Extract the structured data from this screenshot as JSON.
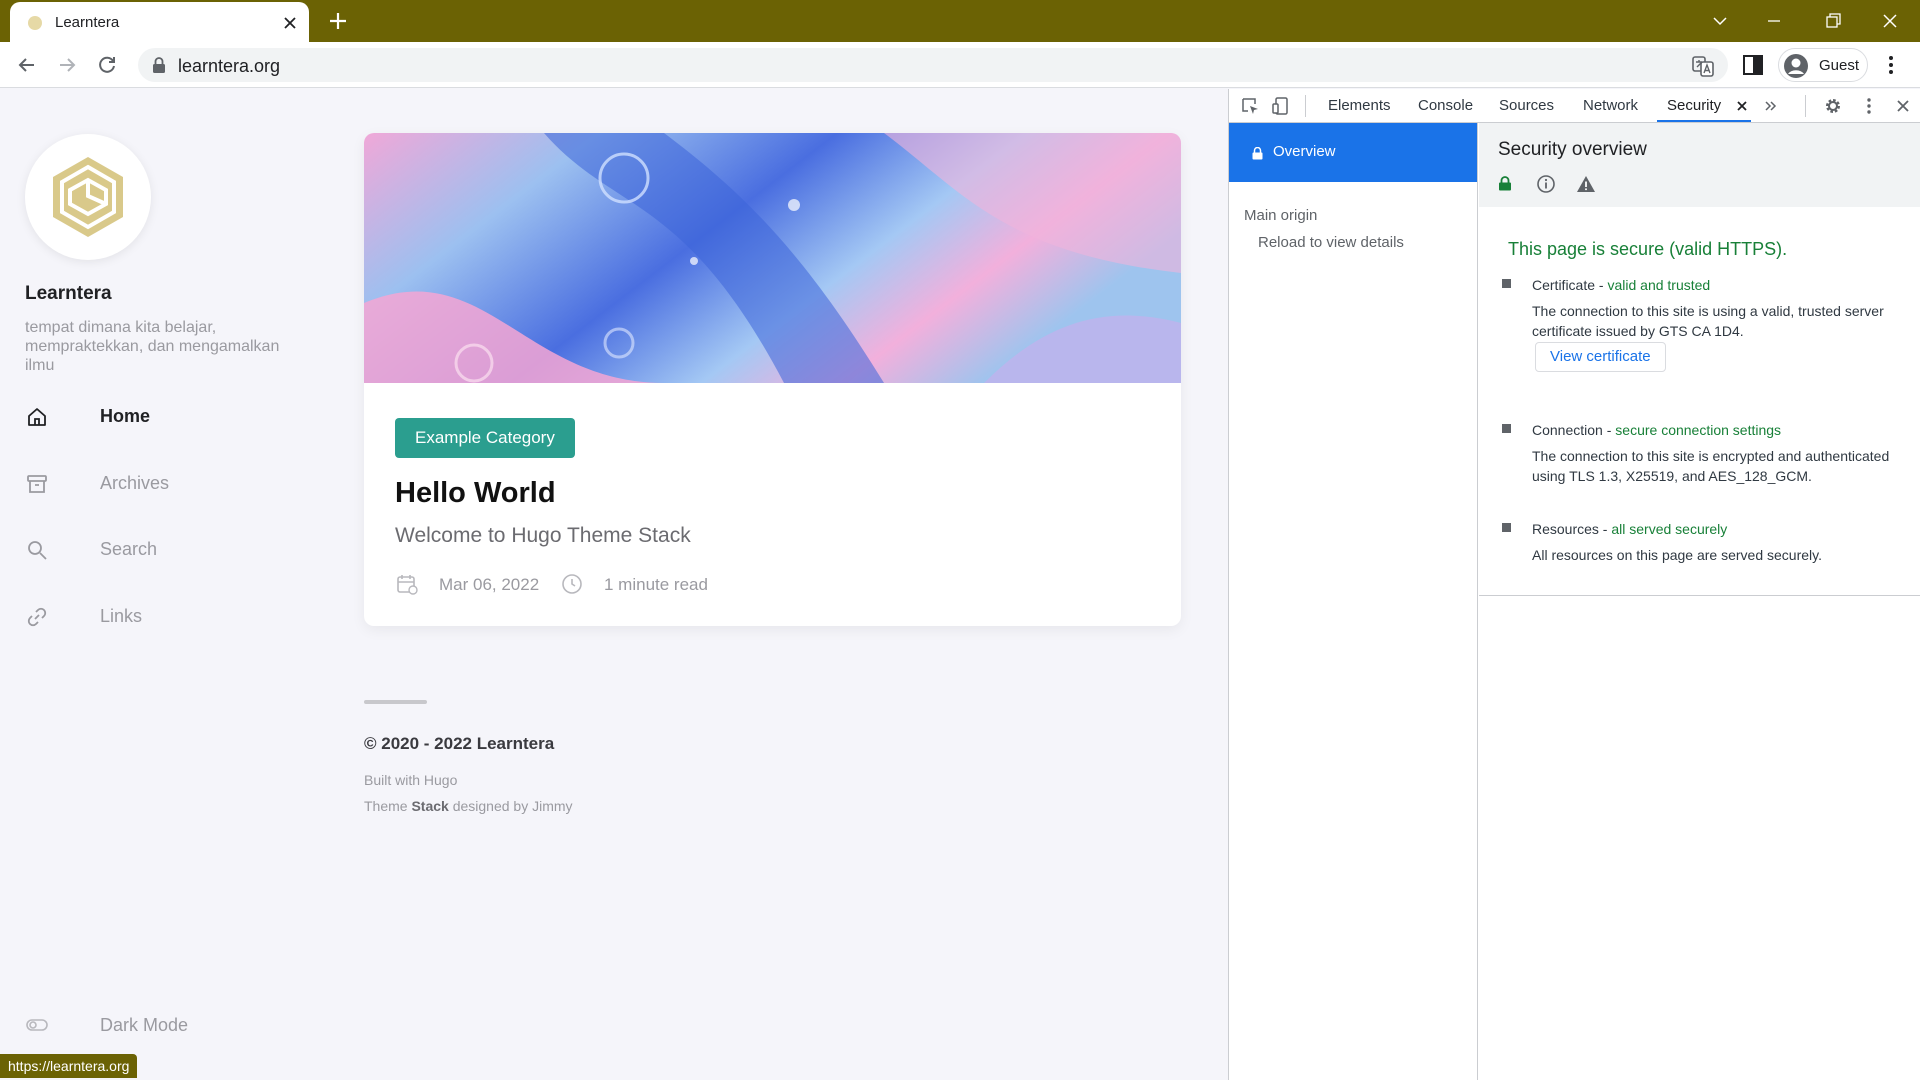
{
  "browser": {
    "tab_title": "Learntera",
    "url": "learntera.org",
    "profile_label": "Guest",
    "status_url": "https://learntera.org",
    "chrome_color": "#6b6204"
  },
  "site": {
    "name": "Learntera",
    "description": "tempat dimana kita belajar, mempraktekkan, dan mengamalkan ilmu",
    "menu": [
      {
        "label": "Home",
        "icon": "home-icon"
      },
      {
        "label": "Archives",
        "icon": "archive-icon"
      },
      {
        "label": "Search",
        "icon": "search-icon"
      },
      {
        "label": "Links",
        "icon": "link-icon"
      }
    ],
    "dark_mode_label": "Dark Mode"
  },
  "article": {
    "category": "Example Category",
    "title": "Hello World",
    "subtitle": "Welcome to Hugo Theme Stack",
    "date": "Mar 06, 2022",
    "read_time": "1 minute read",
    "category_color": "#2b9e8f"
  },
  "footer": {
    "copyright": "© 2020 - 2022 Learntera",
    "built_with": "Built with Hugo",
    "theme_prefix": "Theme ",
    "theme_name": "Stack",
    "theme_suffix": " designed by Jimmy"
  },
  "devtools": {
    "tabs": [
      "Elements",
      "Console",
      "Sources",
      "Network",
      "Security"
    ],
    "active_tab": "Security",
    "sidebar": {
      "overview": "Overview",
      "main_origin": "Main origin",
      "reload": "Reload to view details"
    },
    "overview_title": "Security overview",
    "secure_heading": "This page is secure (valid HTTPS).",
    "sections": [
      {
        "name": "Certificate - ",
        "status": "valid and trusted",
        "description": "The connection to this site is using a valid, trusted server certificate issued by GTS CA 1D4."
      },
      {
        "name": "Connection - ",
        "status": "secure connection settings",
        "description": "The connection to this site is encrypted and authenticated using TLS 1.3, X25519, and AES_128_GCM."
      },
      {
        "name": "Resources - ",
        "status": "all served securely",
        "description": "All resources on this page are served securely."
      }
    ],
    "view_certificate": "View certificate",
    "accent_color": "#1a73e8",
    "secure_color": "#188038"
  }
}
